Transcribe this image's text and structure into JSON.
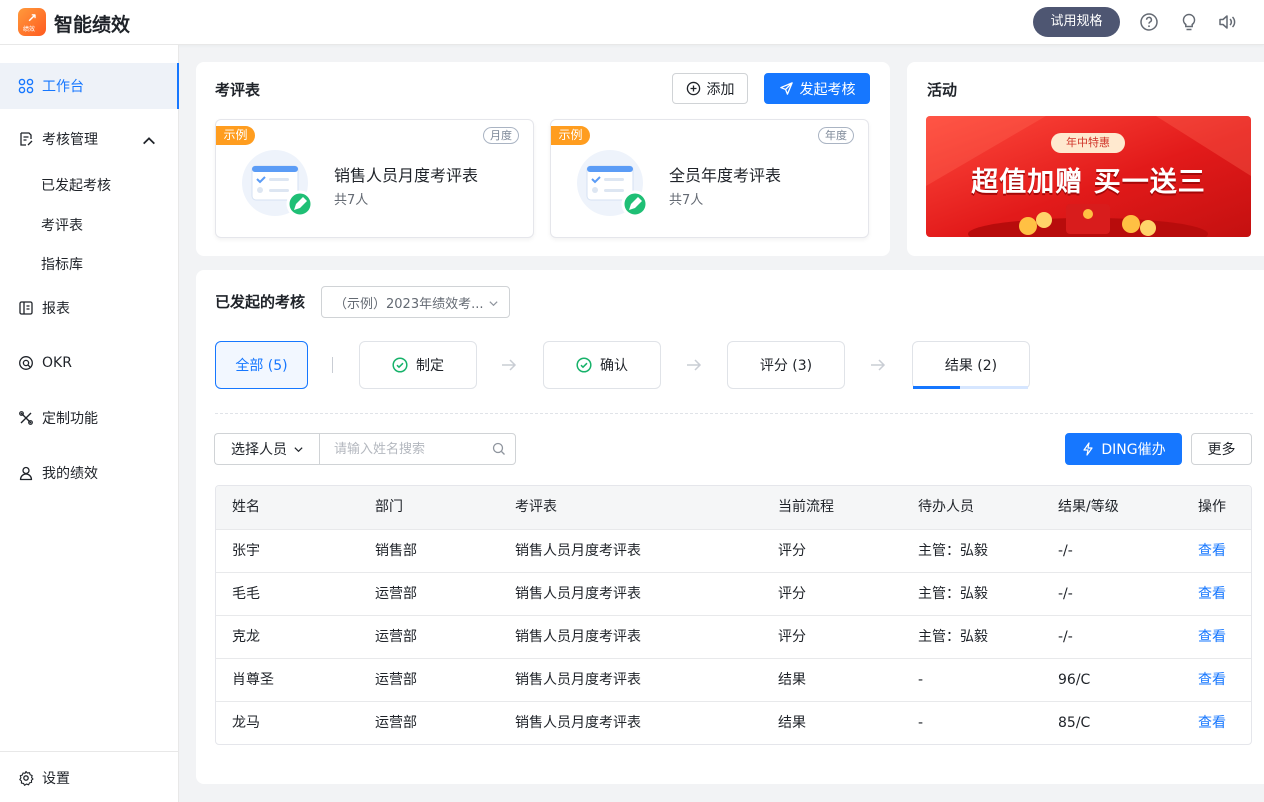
{
  "app": {
    "logo_mark": "↗",
    "logo_text": "绩效",
    "title": "智能绩效",
    "trial_label": "试用规格"
  },
  "sidebar": {
    "workbench": "工作台",
    "review_mgmt": "考核管理",
    "sub_items": [
      "已发起考核",
      "考评表",
      "指标库"
    ],
    "report": "报表",
    "okr": "OKR",
    "custom": "定制功能",
    "my_perf": "我的绩效",
    "settings": "设置"
  },
  "templates": {
    "title": "考评表",
    "add_label": "添加",
    "launch_label": "发起考核",
    "cards": [
      {
        "tag": "示例",
        "period": "月度",
        "name": "销售人员月度考评表",
        "count": "共7人"
      },
      {
        "tag": "示例",
        "period": "年度",
        "name": "全员年度考评表",
        "count": "共7人"
      }
    ]
  },
  "activity": {
    "title": "活动",
    "banner_pill": "年中特惠",
    "banner_headline": "超值加赠 买一送三"
  },
  "launched": {
    "title": "已发起的考核",
    "dropdown_value": "（示例）2023年绩效考...",
    "steps": [
      {
        "label": "全部 (5)",
        "selected": true
      },
      {
        "label": "制定",
        "done": true
      },
      {
        "label": "确认",
        "done": true
      },
      {
        "label": "评分 (3)"
      },
      {
        "label": "结果 (2)"
      }
    ],
    "result_progress": 0.41,
    "filter": {
      "select_label": "选择人员",
      "search_placeholder": "请输入姓名搜索",
      "ding_label": "DING催办",
      "more_label": "更多"
    },
    "table": {
      "headers": [
        "姓名",
        "部门",
        "考评表",
        "当前流程",
        "待办人员",
        "结果/等级",
        "操作"
      ],
      "rows": [
        [
          "张宇",
          "销售部",
          "销售人员月度考评表",
          "评分",
          "主管：弘毅",
          "-/-",
          "查看"
        ],
        [
          "毛毛",
          "运营部",
          "销售人员月度考评表",
          "评分",
          "主管：弘毅",
          "-/-",
          "查看"
        ],
        [
          "克龙",
          "运营部",
          "销售人员月度考评表",
          "评分",
          "主管：弘毅",
          "-/-",
          "查看"
        ],
        [
          "肖尊圣",
          "运营部",
          "销售人员月度考评表",
          "结果",
          "-",
          "96/C",
          "查看"
        ],
        [
          "龙马",
          "运营部",
          "销售人员月度考评表",
          "结果",
          "-",
          "85/C",
          "查看"
        ]
      ]
    }
  },
  "colors": {
    "primary": "#1677ff",
    "tag_orange": "#ff9d1f",
    "success_green": "#17b26a",
    "banner_red": "#e21a1a"
  }
}
